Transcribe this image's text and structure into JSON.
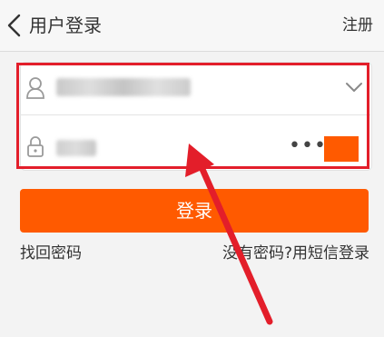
{
  "header": {
    "back_icon": "chevron-left-icon",
    "title": "用户登录",
    "register_label": "注册"
  },
  "form": {
    "username": {
      "icon": "user-icon",
      "value_obscured": true,
      "dropdown_icon": "chevron-down-icon"
    },
    "password": {
      "icon": "lock-icon",
      "value_obscured": true,
      "mask_text": "•••",
      "toggle_color": "#ff5a00"
    }
  },
  "login_button_label": "登录",
  "forgot_password_label": "找回密码",
  "sms_login_label": "没有密码?用短信登录",
  "annotation": {
    "highlight_color": "#e31e2a",
    "arrow_color": "#e31e2a"
  },
  "colors": {
    "accent": "#ff5a00",
    "background": "#f3f3f3",
    "text": "#333333"
  }
}
